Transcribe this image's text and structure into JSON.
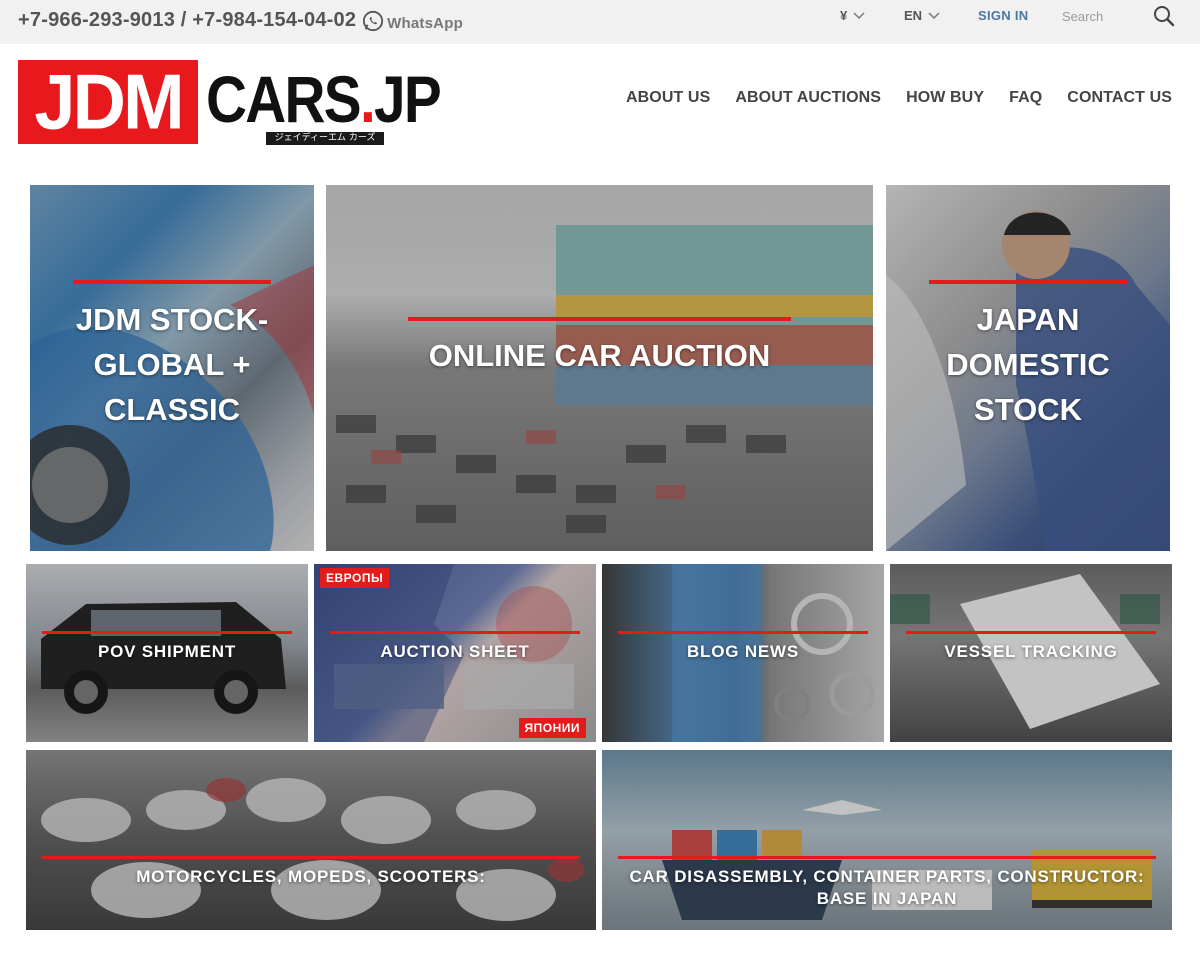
{
  "topbar": {
    "phones": "+7-966-293-9013 / +7-984-154-04-02",
    "whatsapp_label": "WhatsApp",
    "currency": "¥",
    "language": "EN",
    "signin": "SIGN IN",
    "search_placeholder": "Search"
  },
  "logo": {
    "jdm": "JDM",
    "cars": "CARS",
    "dot": ".",
    "jp": "JP",
    "subtitle": "ジェイディーエム カーズ"
  },
  "nav": {
    "items": [
      {
        "label": "ABOUT US"
      },
      {
        "label": "ABOUT AUCTIONS"
      },
      {
        "label": "HOW BUY"
      },
      {
        "label": "FAQ"
      },
      {
        "label": "CONTACT US"
      }
    ]
  },
  "tiles": {
    "jdm_stock": {
      "line1": "JDM STOCK-",
      "line2": "GLOBAL +",
      "line3": "CLASSIC"
    },
    "online_auction": {
      "line1": "ONLINE CAR AUCTION"
    },
    "japan_domestic": {
      "line1": "JAPAN",
      "line2": "DOMESTIC",
      "line3": "STOCK"
    },
    "pov_shipment": {
      "label": "POV SHIPMENT"
    },
    "auction_sheet": {
      "label": "AUCTION SHEET",
      "badge_top": "ЕВРОПЫ",
      "badge_bottom": "ЯПОНИИ"
    },
    "blog_news": {
      "label": "BLOG NEWS"
    },
    "vessel_tracking": {
      "label": "VESSEL TRACKING"
    },
    "motorcycles": {
      "label": "MOTORCYCLES, MOPEDS, SCOOTERS:"
    },
    "disassembly": {
      "line1": "CAR DISASSEMBLY, CONTAINER PARTS, CONSTRUCTOR:",
      "line2": "BASE IN JAPAN"
    }
  },
  "colors": {
    "accent_red": "#e31b1b",
    "signin_blue": "#4b77a5",
    "topbar_bg": "#f1f1f1"
  }
}
